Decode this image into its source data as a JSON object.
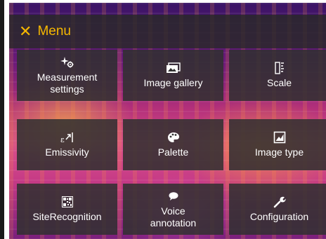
{
  "header": {
    "close_glyph": "✕",
    "title": "Menu",
    "accent_color": "#f6b800"
  },
  "tiles": [
    {
      "label": "Measurement settings",
      "icon": "measurement-settings-icon"
    },
    {
      "label": "Image gallery",
      "icon": "image-gallery-icon"
    },
    {
      "label": "Scale",
      "icon": "scale-icon"
    },
    {
      "label": "Emissivity",
      "icon": "emissivity-icon"
    },
    {
      "label": "Palette",
      "icon": "palette-icon"
    },
    {
      "label": "Image type",
      "icon": "image-type-icon"
    },
    {
      "label": "SiteRecognition",
      "icon": "qr-code-icon"
    },
    {
      "label": "Voice annotation",
      "icon": "speech-bubble-icon"
    },
    {
      "label": "Configuration",
      "icon": "wrench-icon"
    }
  ]
}
